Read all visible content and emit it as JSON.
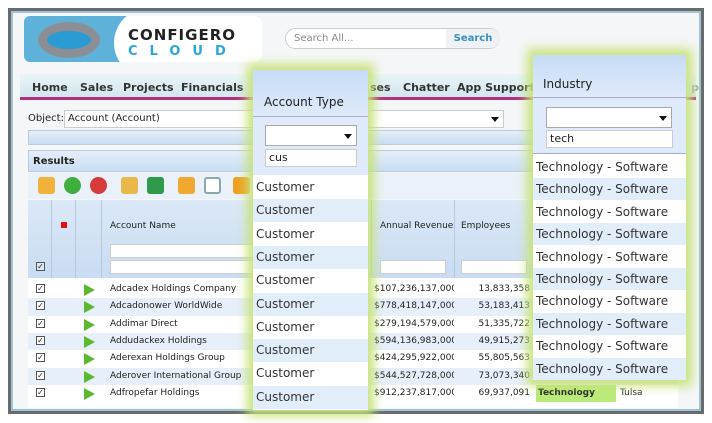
{
  "brand": {
    "line1": "CONFIGERO",
    "line2": "CLOUD"
  },
  "search": {
    "placeholder": "Search All...",
    "button": "Search"
  },
  "nav": [
    "Home",
    "Sales",
    "Projects",
    "Financials",
    "ses",
    "Chatter",
    "App Support",
    "p"
  ],
  "object": {
    "label": "Object:",
    "value": "Account (Account)"
  },
  "results": {
    "title": "Results"
  },
  "toolbar": [
    "save-icon",
    "add-icon",
    "delete-icon",
    "clear-icon",
    "excel-icon",
    "refresh-icon",
    "columns-icon",
    "upload-icon"
  ],
  "grid": {
    "columns": {
      "account_name": "Account Name",
      "annual_revenue": "Annual Revenue",
      "employees": "Employees"
    },
    "rows": [
      {
        "name": "Adcadex Holdings Company",
        "revenue": "$107,236,137,000,",
        "employees": "13,833,358"
      },
      {
        "name": "Adcadonower WorldWide",
        "revenue": "$778,418,147,000,",
        "employees": "53,183,413"
      },
      {
        "name": "Addimar Direct",
        "revenue": "$279,194,579,000,",
        "employees": "51,335,722"
      },
      {
        "name": "Addudackex Holdings",
        "revenue": "$594,136,983,000,",
        "employees": "49,915,273"
      },
      {
        "name": "Aderexan Holdings Group",
        "revenue": "$424,295,922,000,",
        "employees": "55,805,563"
      },
      {
        "name": "Aderover International Group",
        "revenue": "$544,527,728,000,",
        "employees": "73,073,340"
      },
      {
        "name": "Adfropefar Holdings",
        "revenue": "$912,237,817,000,",
        "employees": "69,937,091",
        "industry": "Technology",
        "city": "Tulsa"
      }
    ]
  },
  "account_type_popup": {
    "title": "Account Type",
    "filter": "cus",
    "items": [
      "Customer",
      "Customer",
      "Customer",
      "Customer",
      "Customer",
      "Customer",
      "Customer",
      "Customer",
      "Customer",
      "Customer"
    ]
  },
  "industry_popup": {
    "title": "Industry",
    "filter": "tech",
    "items": [
      "Technology - Software",
      "Technology - Software",
      "Technology - Software",
      "Technology - Software",
      "Technology - Software",
      "Technology - Software",
      "Technology - Software",
      "Technology - Software",
      "Technology - Software",
      "Technology - Software"
    ]
  }
}
